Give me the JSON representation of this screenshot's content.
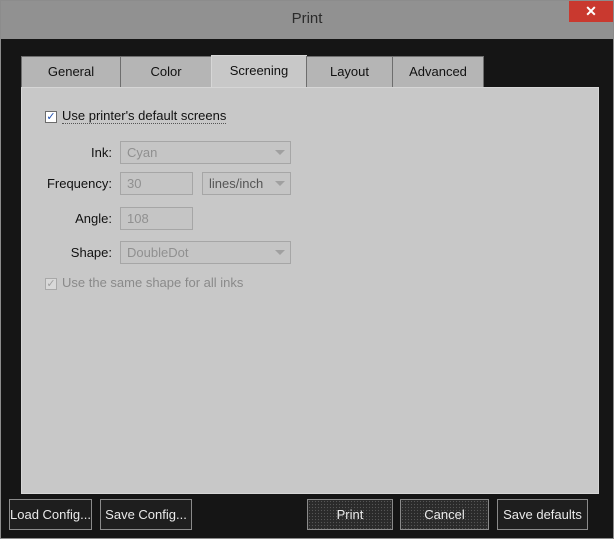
{
  "window": {
    "title": "Print",
    "close_label": "✕"
  },
  "tabs": [
    {
      "label": "General",
      "active": false
    },
    {
      "label": "Color",
      "active": false
    },
    {
      "label": "Screening",
      "active": true
    },
    {
      "label": "Layout",
      "active": false
    },
    {
      "label": "Advanced",
      "active": false
    }
  ],
  "screening": {
    "use_default_screens": {
      "label": "Use printer's default screens",
      "checked": true
    },
    "ink": {
      "label": "Ink:",
      "value": "Cyan"
    },
    "frequency": {
      "label": "Frequency:",
      "value": "30",
      "unit": "lines/inch"
    },
    "angle": {
      "label": "Angle:",
      "value": "108"
    },
    "shape": {
      "label": "Shape:",
      "value": "DoubleDot"
    },
    "same_shape_all_inks": {
      "label": "Use the same shape for all inks",
      "checked": true,
      "enabled": false
    }
  },
  "footer": {
    "load_config": "Load Config...",
    "save_config": "Save Config...",
    "print": "Print",
    "cancel": "Cancel",
    "save_defaults": "Save defaults"
  },
  "colors": {
    "window_bg": "#151515",
    "panel_bg": "#c8c8c8",
    "close_button": "#c9392f",
    "checkbox_check": "#2050b0"
  },
  "icons": {
    "close": "close-icon",
    "checkmark": "checkmark-icon",
    "dropdown": "chevron-down-icon"
  }
}
